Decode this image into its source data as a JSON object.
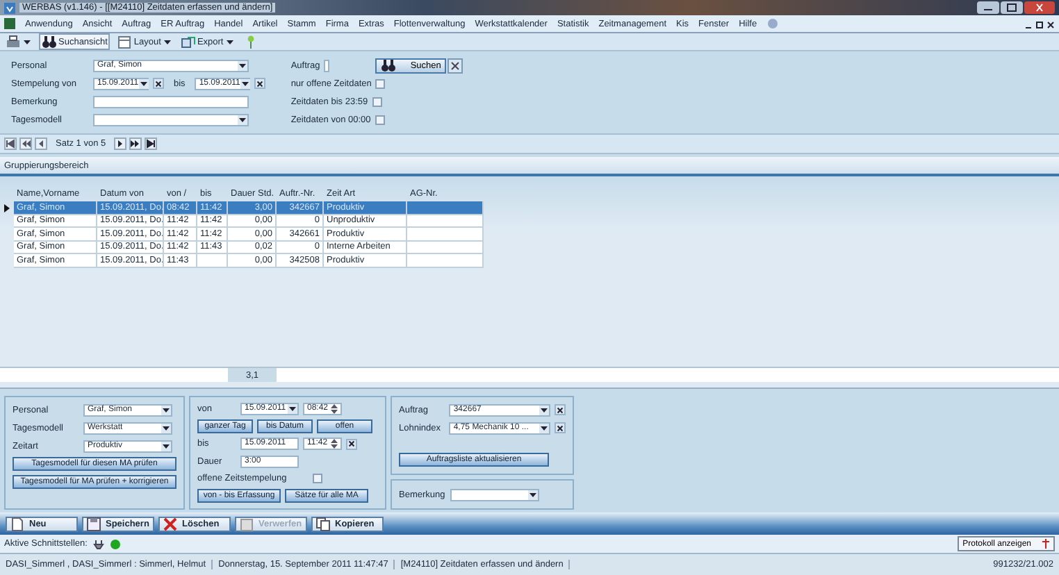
{
  "window": {
    "title": "WERBAS (v1.146) - [[M24110] Zeitdaten erfassen und ändern]"
  },
  "menu": [
    "Anwendung",
    "Ansicht",
    "Auftrag",
    "ER Auftrag",
    "Handel",
    "Artikel",
    "Stamm",
    "Firma",
    "Extras",
    "Flottenverwaltung",
    "Werkstattkalender",
    "Statistik",
    "Zeitmanagement",
    "Kis",
    "Fenster",
    "Hilfe"
  ],
  "toolbar": [
    {
      "kind": "printer",
      "dropdown": true
    },
    {
      "kind": "binoculars",
      "label": "Suchansicht",
      "dropdown": false
    },
    {
      "kind": "layout",
      "label": "Layout",
      "dropdown": true
    },
    {
      "kind": "export",
      "label": "Export",
      "dropdown": true
    },
    {
      "kind": "pin",
      "dropdown": false
    }
  ],
  "search": {
    "fields": [
      {
        "kind": "combo",
        "label": "Personal",
        "value": "Graf, Simon"
      },
      {
        "kind": "daterange",
        "label": "Stempelung von",
        "value": "15.09.2011",
        "to_label": "bis",
        "to_value": "15.09.2011"
      },
      {
        "kind": "text",
        "label": "Bemerkung"
      },
      {
        "kind": "combo",
        "label": "Tagesmodell"
      }
    ],
    "order_label": "Auftrag",
    "options": [
      {
        "label": "nur offene Zeitdaten",
        "checked": false
      },
      {
        "label": "Zeitdaten bis 23:59",
        "checked": false
      },
      {
        "label": "Zeitdaten von 00:00",
        "checked": false
      }
    ],
    "search_button": "Suchen"
  },
  "nav": {
    "record": "Satz 1 von 5"
  },
  "grouping": "Gruppierungsbereich",
  "table": {
    "columns": [
      "Name,Vorname",
      "Datum von",
      "von /",
      "bis",
      "Dauer Std.",
      "Auftr.-Nr.",
      "Zeit Art",
      "AG-Nr."
    ],
    "rows": [
      {
        "selected": true,
        "cells": [
          "Graf, Simon",
          "15.09.2011, Do.",
          "08:42",
          "11:42",
          "3,00",
          "342667",
          "Produktiv",
          ""
        ]
      },
      {
        "selected": false,
        "cells": [
          "Graf, Simon",
          "15.09.2011, Do.",
          "11:42",
          "11:42",
          "0,00",
          "0",
          "Unproduktiv",
          ""
        ]
      },
      {
        "selected": false,
        "cells": [
          "Graf, Simon",
          "15.09.2011, Do.",
          "11:42",
          "11:42",
          "0,00",
          "342661",
          "Produktiv",
          ""
        ]
      },
      {
        "selected": false,
        "cells": [
          "Graf, Simon",
          "15.09.2011, Do.",
          "11:42",
          "11:43",
          "0,02",
          "0",
          "Interne Arbeiten",
          ""
        ]
      },
      {
        "selected": false,
        "cells": [
          "Graf, Simon",
          "15.09.2011, Do.",
          "11:43",
          "",
          "0,00",
          "342508",
          "Produktiv",
          ""
        ]
      }
    ],
    "total": "3,1"
  },
  "detail": {
    "person": {
      "fields": [
        {
          "label": "Personal",
          "value": "Graf, Simon"
        },
        {
          "label": "Tagesmodell",
          "value": "Werkstatt"
        },
        {
          "label": "Zeitart",
          "value": "Produktiv"
        }
      ],
      "buttons": [
        "Tagesmodell für diesen MA prüfen",
        "Tagesmodell für MA prüfen + korrigieren"
      ]
    },
    "time": {
      "from_label": "von",
      "from_date": "15.09.2011",
      "from_time": "08:42",
      "quick_buttons": [
        "ganzer Tag",
        "bis Datum",
        "offen"
      ],
      "to_label": "bis",
      "to_date": "15.09.2011",
      "to_time": "11:42",
      "duration_label": "Dauer",
      "duration": "3:00",
      "open_label": "offene Zeitstempelung",
      "open_checked": false,
      "buttons": [
        "von - bis Erfassung",
        "Sätze für alle MA"
      ]
    },
    "order": {
      "fields": [
        {
          "label": "Auftrag",
          "value": "342667"
        },
        {
          "label": "Lohnindex",
          "value": "4,75 Mechanik 10 ..."
        }
      ],
      "button": "Auftragsliste aktualisieren",
      "remark_label": "Bemerkung"
    }
  },
  "actions": [
    {
      "kind": "new",
      "label": "Neu",
      "disabled": false
    },
    {
      "kind": "save",
      "label": "Speichern",
      "disabled": false
    },
    {
      "kind": "delete",
      "label": "Löschen",
      "disabled": false
    },
    {
      "kind": "discard",
      "label": "Verwerfen",
      "disabled": true
    },
    {
      "kind": "copy",
      "label": "Kopieren",
      "disabled": false
    }
  ],
  "interfaces": {
    "label": "Aktive Schnittstellen:",
    "protocol_button": "Protokoll anzeigen"
  },
  "status_bar": [
    "DASI_Simmerl , DASI_Simmerl : Simmerl, Helmut",
    "Donnerstag, 15. September 2011 11:47:47",
    "[M24110] Zeitdaten erfassen und ändern",
    "991232/21.002"
  ]
}
